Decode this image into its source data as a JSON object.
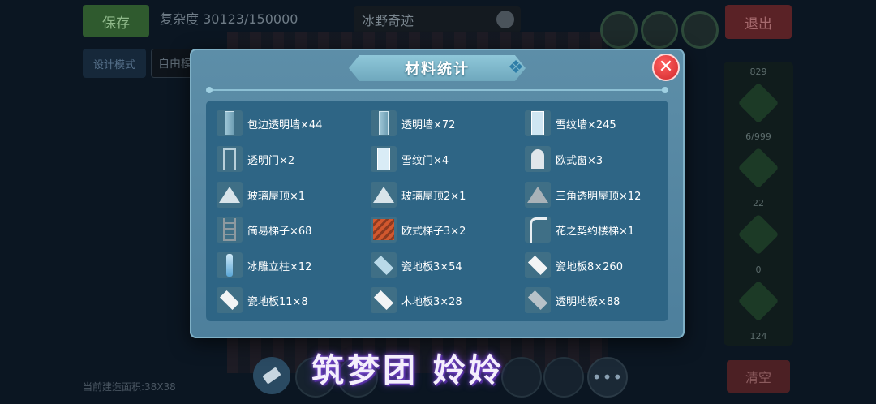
{
  "background": {
    "save_label": "保存",
    "complexity_text": "复杂度 30123/150000",
    "map_name": "冰野奇迹",
    "exit_label": "退出",
    "design_mode_label": "设计模式",
    "free_mode_label": "自由模",
    "right_panel_counts": [
      "829",
      "6/999",
      "22",
      "0",
      "124"
    ],
    "clear_label": "清空",
    "area_text": "当前建造面积:38X38",
    "more_label": "•••"
  },
  "modal": {
    "title": "材料统计",
    "close_label": "✕",
    "items": [
      {
        "label": "包边透明墙×44",
        "icon": "edged-glass-wall-icon"
      },
      {
        "label": "透明墙×72",
        "icon": "glass-wall-icon"
      },
      {
        "label": "雪纹墙×245",
        "icon": "snow-pattern-wall-icon"
      },
      {
        "label": "透明门×2",
        "icon": "glass-door-icon"
      },
      {
        "label": "雪纹门×4",
        "icon": "snow-pattern-door-icon"
      },
      {
        "label": "欧式窗×3",
        "icon": "european-window-icon"
      },
      {
        "label": "玻璃屋顶×1",
        "icon": "glass-roof-icon"
      },
      {
        "label": "玻璃屋顶2×1",
        "icon": "glass-roof-2-icon"
      },
      {
        "label": "三角透明屋顶×12",
        "icon": "triangle-glass-roof-icon"
      },
      {
        "label": "简易梯子×68",
        "icon": "simple-ladder-icon"
      },
      {
        "label": "欧式梯子3×2",
        "icon": "european-ladder-icon"
      },
      {
        "label": "花之契约楼梯×1",
        "icon": "flower-staircase-icon"
      },
      {
        "label": "冰雕立柱×12",
        "icon": "ice-pillar-icon"
      },
      {
        "label": "瓷地板3×54",
        "icon": "tile-floor-3-icon"
      },
      {
        "label": "瓷地板8×260",
        "icon": "tile-floor-8-icon"
      },
      {
        "label": "瓷地板11×8",
        "icon": "tile-floor-11-icon"
      },
      {
        "label": "木地板3×28",
        "icon": "wood-floor-icon"
      },
      {
        "label": "透明地板×88",
        "icon": "glass-floor-icon"
      }
    ]
  },
  "watermark": "筑梦团 姈姈",
  "colors": {
    "modal_bg": "#5d8ea8",
    "items_bg": "#2e6585",
    "close_red": "#d0282c",
    "title_banner": "#8fc7d9"
  }
}
